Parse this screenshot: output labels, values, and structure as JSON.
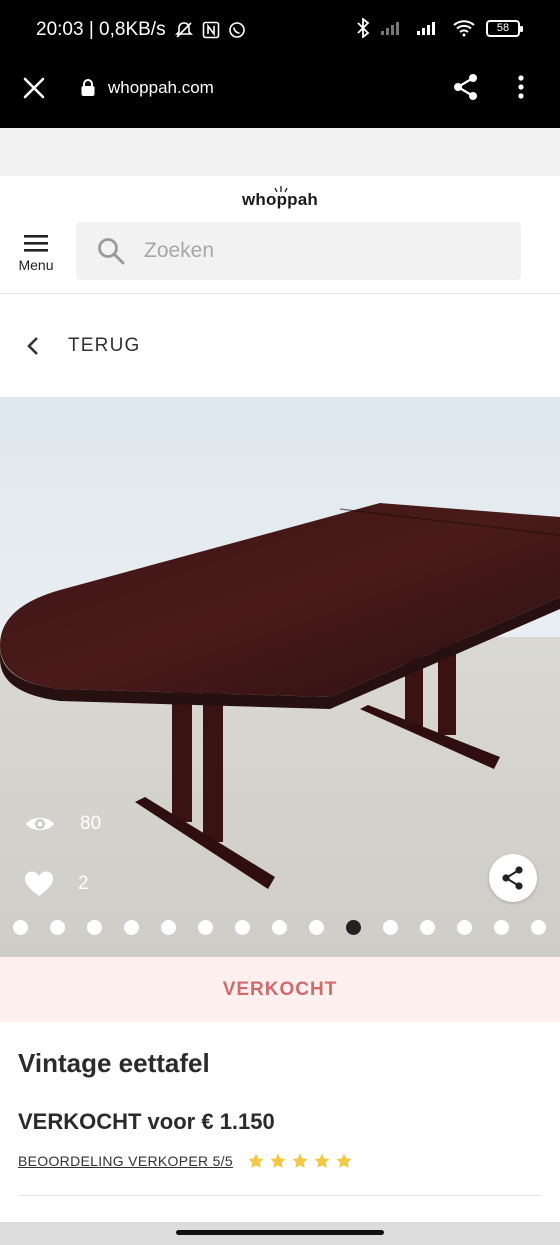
{
  "status_bar": {
    "time_speed": "20:03 | 0,8KB/s",
    "battery": "58"
  },
  "browser": {
    "url": "whoppah.com"
  },
  "header": {
    "logo": "whoppah",
    "menu_label": "Menu",
    "search_placeholder": "Zoeken"
  },
  "back": {
    "label": "TERUG"
  },
  "gallery": {
    "views": "80",
    "likes": "2",
    "dot_count": 15,
    "active_dot": 10
  },
  "product": {
    "sold_banner": "VERKOCHT",
    "title": "Vintage eettafel",
    "price": "VERKOCHT voor € 1.150",
    "seller_rating_label": "BEOORDELING VERKOPER 5/5",
    "star_rating": 5
  },
  "colors": {
    "sold_text": "#d26a6c",
    "sold_bg": "#fdf0ef",
    "star": "#f5c842"
  }
}
